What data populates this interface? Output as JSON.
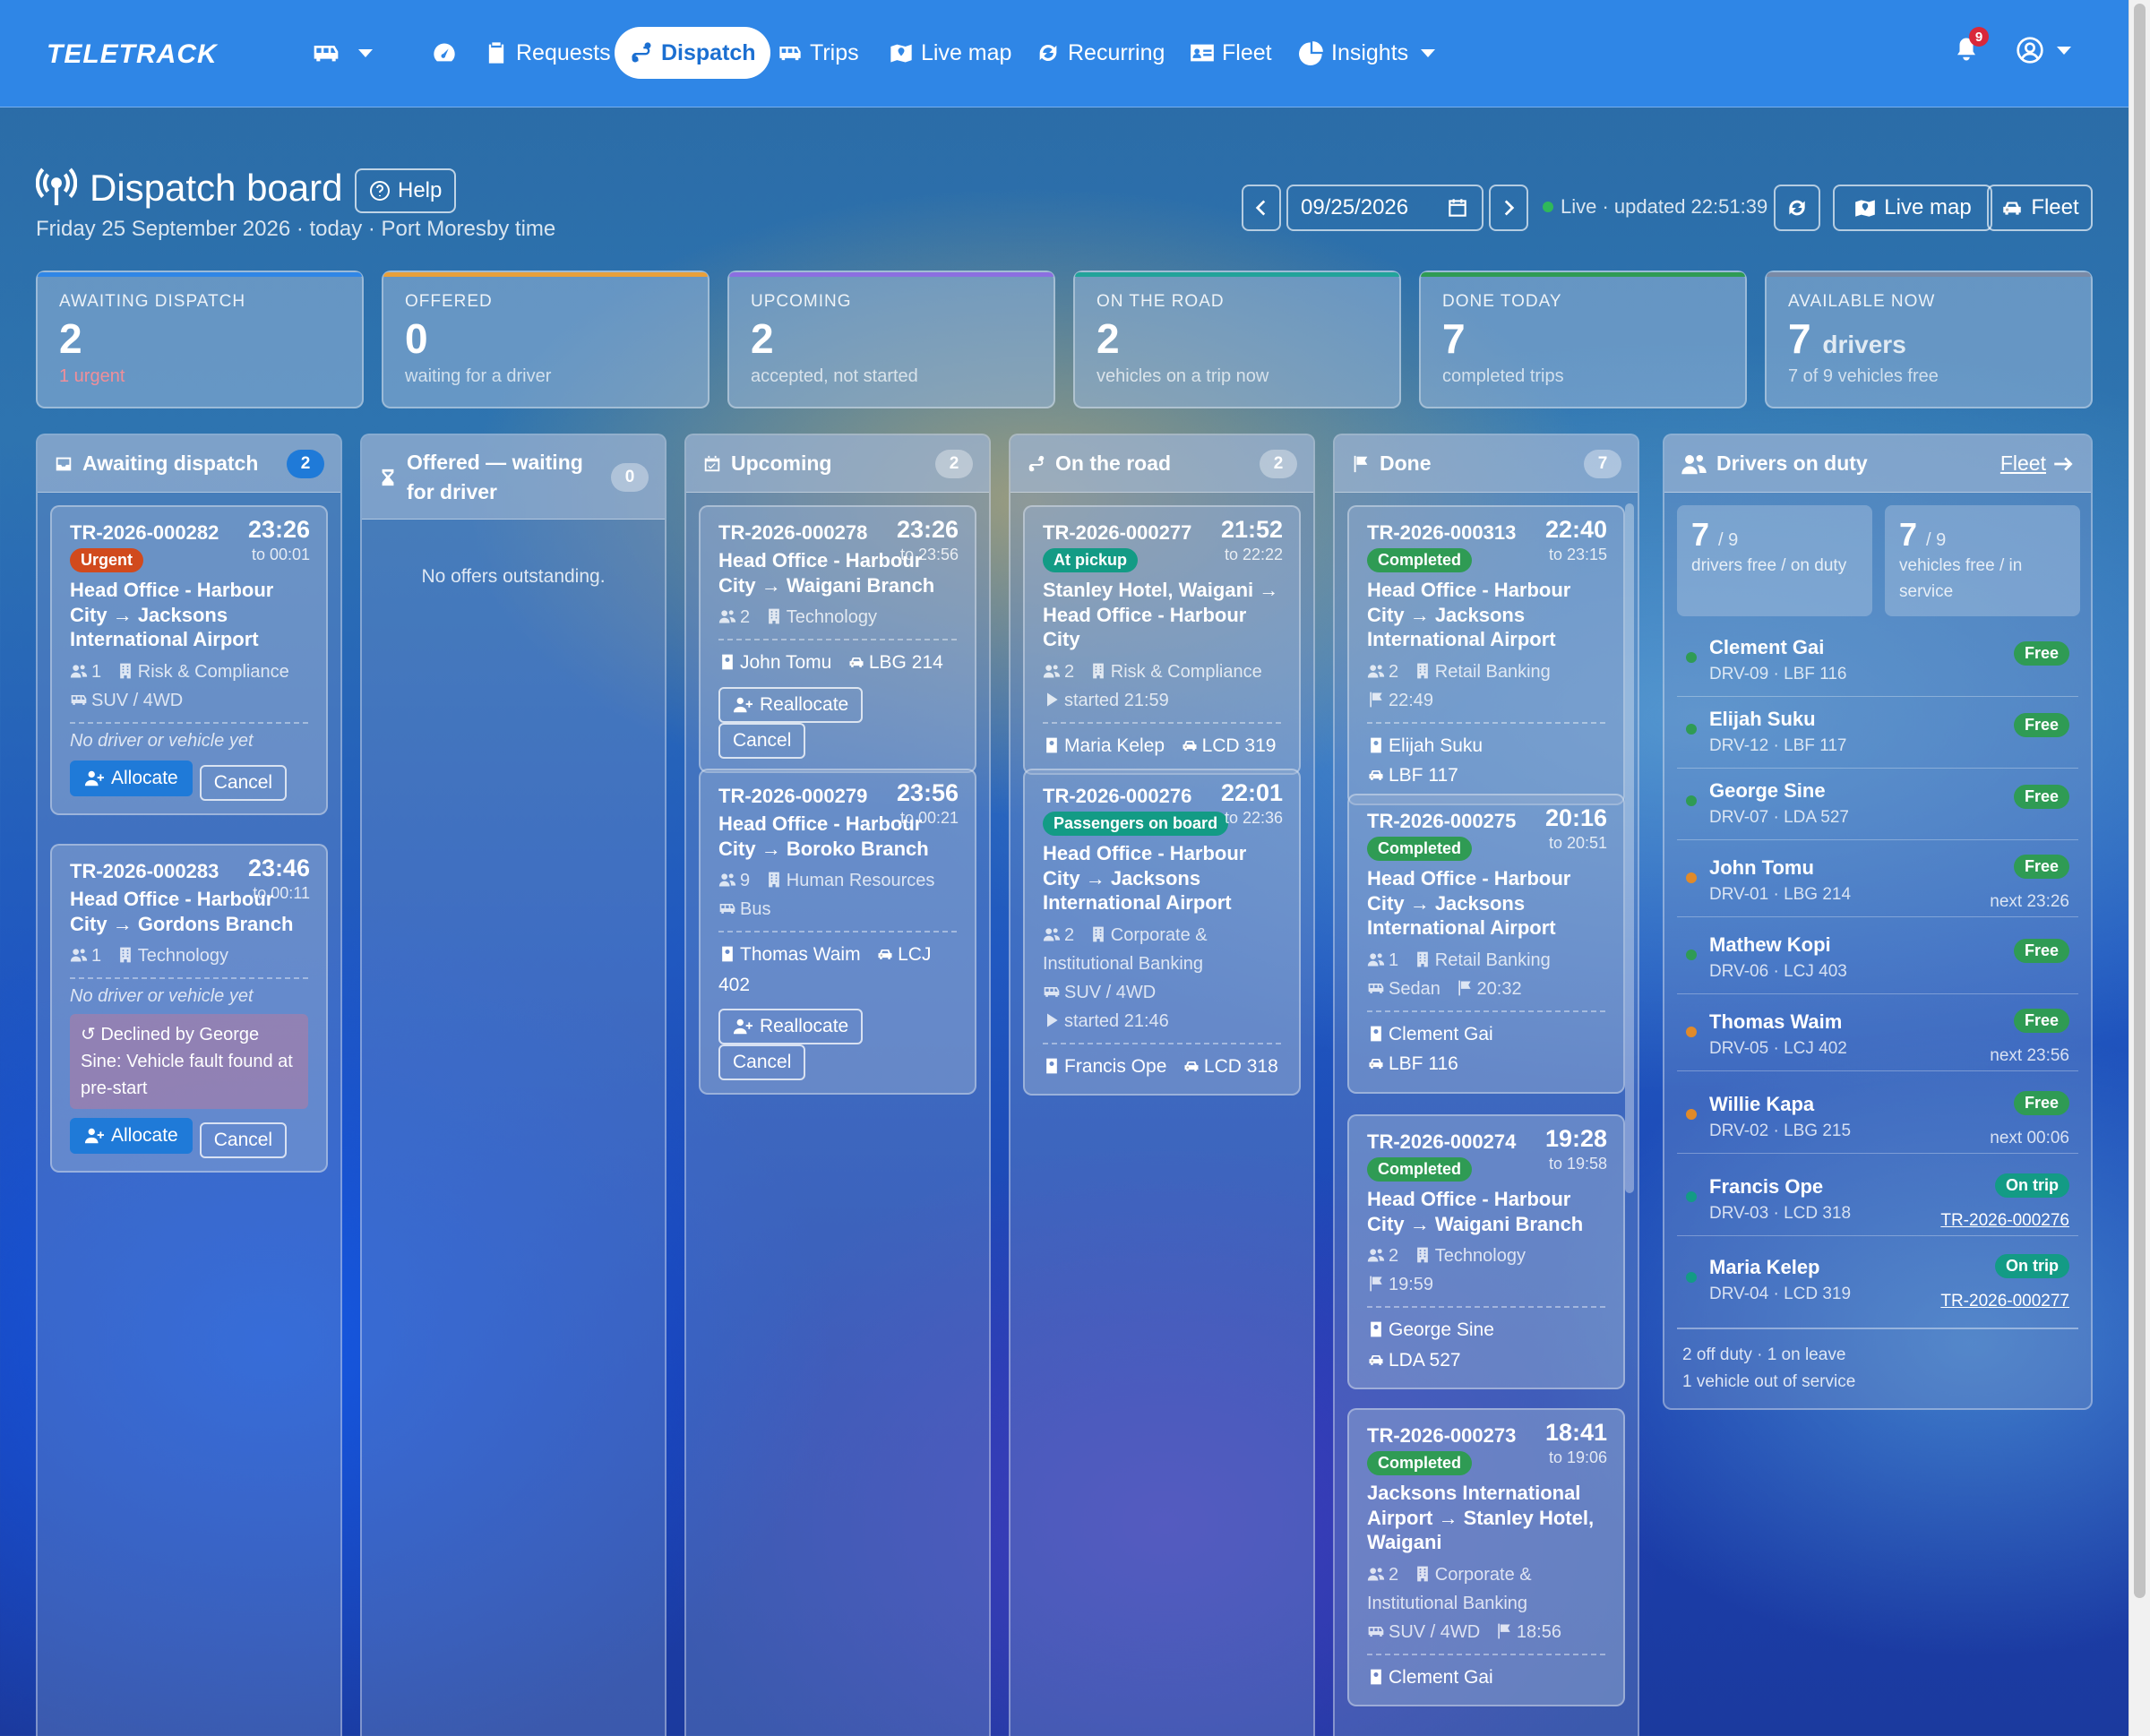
{
  "app": {
    "logo": "TELETRACK",
    "notifications": "9"
  },
  "nav": {
    "requests": "Requests",
    "dispatch": "Dispatch",
    "trips": "Trips",
    "live_map": "Live map",
    "recurring": "Recurring",
    "fleet": "Fleet",
    "insights": "Insights"
  },
  "header": {
    "title": "Dispatch board",
    "help": "Help",
    "subtitle": "Friday 25 September 2026 · today · Port Moresby time",
    "date": "09/25/2026",
    "live": "Live · updated 22:51:39",
    "live_map": "Live map",
    "fleet": "Fleet"
  },
  "stats": [
    {
      "label": "AWAITING DISPATCH",
      "value": "2",
      "sub": "1 urgent",
      "color": "#2f86e6"
    },
    {
      "label": "OFFERED",
      "value": "0",
      "sub": "waiting for a driver",
      "color": "#e8a03b"
    },
    {
      "label": "UPCOMING",
      "value": "2",
      "sub": "accepted, not started",
      "color": "#8b6fe0"
    },
    {
      "label": "ON THE ROAD",
      "value": "2",
      "sub": "vehicles on a trip now",
      "color": "#22a39a"
    },
    {
      "label": "DONE TODAY",
      "value": "7",
      "sub": "completed trips",
      "color": "#2f9b54"
    },
    {
      "label": "AVAILABLE NOW",
      "value": "7",
      "unit": "drivers",
      "sub": "7 of 9 vehicles free",
      "color": "#7a8aa6"
    }
  ],
  "columns": {
    "awaiting": {
      "title": "Awaiting dispatch",
      "count": "2"
    },
    "offered": {
      "title": "Offered — waiting for driver",
      "count": "0",
      "empty": "No offers outstanding."
    },
    "upcoming": {
      "title": "Upcoming",
      "count": "2"
    },
    "road": {
      "title": "On the road",
      "count": "2"
    },
    "done": {
      "title": "Done",
      "count": "7"
    },
    "drivers": {
      "title": "Drivers on duty",
      "link": "Fleet"
    }
  },
  "awaiting": [
    {
      "id": "TR-2026-000282",
      "time": "23:26",
      "to": "to 00:01",
      "badge": "Urgent",
      "from": "Head Office - Harbour City",
      "dest": "Jacksons International Airport",
      "pax": "1",
      "dept": "Risk & Compliance",
      "vehicle": "SUV / 4WD",
      "none": "No driver or vehicle yet",
      "allocate": "Allocate",
      "cancel": "Cancel"
    },
    {
      "id": "TR-2026-000283",
      "time": "23:46",
      "to": "to 00:11",
      "from": "Head Office - Harbour City",
      "dest": "Gordons Branch",
      "pax": "1",
      "dept": "Technology",
      "none": "No driver or vehicle yet",
      "declined": "Declined by George Sine: Vehicle fault found at pre-start",
      "allocate": "Allocate",
      "cancel": "Cancel"
    }
  ],
  "upcoming": [
    {
      "id": "TR-2026-000278",
      "time": "23:26",
      "to": "to 23:56",
      "from": "Head Office - Harbour City",
      "dest": "Waigani Branch",
      "pax": "2",
      "dept": "Technology",
      "driver": "John Tomu",
      "plate": "LBG 214",
      "realloc": "Reallocate",
      "cancel": "Cancel"
    },
    {
      "id": "TR-2026-000279",
      "time": "23:56",
      "to": "to 00:21",
      "from": "Head Office - Harbour City",
      "dest": "Boroko Branch",
      "pax": "9",
      "dept": "Human Resources",
      "vehicle": "Bus",
      "driver": "Thomas Waim",
      "plate": "LCJ 402",
      "realloc": "Reallocate",
      "cancel": "Cancel"
    }
  ],
  "road": [
    {
      "id": "TR-2026-000277",
      "time": "21:52",
      "to": "to 22:22",
      "badge": "At pickup",
      "from": "Stanley Hotel, Waigani",
      "dest": "Head Office - Harbour City",
      "pax": "2",
      "dept": "Risk & Compliance",
      "started": "started 21:59",
      "driver": "Maria Kelep",
      "plate": "LCD 319"
    },
    {
      "id": "TR-2026-000276",
      "time": "22:01",
      "to": "to 22:36",
      "badge": "Passengers on board",
      "from": "Head Office - Harbour City",
      "dest": "Jacksons International Airport",
      "pax": "2",
      "dept": "Corporate & Institutional Banking",
      "vehicle": "SUV / 4WD",
      "started": "started 21:46",
      "driver": "Francis Ope",
      "plate": "LCD 318"
    }
  ],
  "done": [
    {
      "id": "TR-2026-000313",
      "time": "22:40",
      "to": "to 23:15",
      "badge": "Completed",
      "from": "Head Office - Harbour City",
      "dest": "Jacksons International Airport",
      "pax": "2",
      "dept": "Retail Banking",
      "fin": "22:49",
      "driver": "Elijah Suku",
      "plate": "LBF 117"
    },
    {
      "id": "TR-2026-000275",
      "time": "20:16",
      "to": "to 20:51",
      "badge": "Completed",
      "from": "Head Office - Harbour City",
      "dest": "Jacksons International Airport",
      "pax": "1",
      "dept": "Retail Banking",
      "vehicle": "Sedan",
      "fin": "20:32",
      "driver": "Clement Gai",
      "plate": "LBF 116"
    },
    {
      "id": "TR-2026-000274",
      "time": "19:28",
      "to": "to 19:58",
      "badge": "Completed",
      "from": "Head Office - Harbour City",
      "dest": "Waigani Branch",
      "pax": "2",
      "dept": "Technology",
      "fin": "19:59",
      "driver": "George Sine",
      "plate": "LDA 527"
    },
    {
      "id": "TR-2026-000273",
      "time": "18:41",
      "to": "to 19:06",
      "badge": "Completed",
      "from": "Jacksons International Airport",
      "dest": "Stanley Hotel, Waigani",
      "pax": "2",
      "dept": "Corporate & Institutional Banking",
      "vehicle": "SUV / 4WD",
      "fin": "18:56",
      "driver": "Clement Gai"
    }
  ],
  "drivers_summary": {
    "drivers_free": "7",
    "drivers_total": "/ 9",
    "drivers_label": "drivers free / on duty",
    "vehicles_free": "7",
    "vehicles_total": "/ 9",
    "vehicles_label": "vehicles free / in service",
    "footer1": "2 off duty · 1 on leave",
    "footer2": "1 vehicle out of service"
  },
  "drivers": [
    {
      "name": "Clement Gai",
      "code": "DRV-09 · LBF 116",
      "status": "Free",
      "dot": "#2f9b54"
    },
    {
      "name": "Elijah Suku",
      "code": "DRV-12 · LBF 117",
      "status": "Free",
      "dot": "#2f9b54"
    },
    {
      "name": "George Sine",
      "code": "DRV-07 · LDA 527",
      "status": "Free",
      "dot": "#2f9b54"
    },
    {
      "name": "John Tomu",
      "code": "DRV-01 · LBG 214",
      "status": "Free",
      "next": "next 23:26",
      "dot": "#e08a2a"
    },
    {
      "name": "Mathew Kopi",
      "code": "DRV-06 · LCJ 403",
      "status": "Free",
      "dot": "#2f9b54"
    },
    {
      "name": "Thomas Waim",
      "code": "DRV-05 · LCJ 402",
      "status": "Free",
      "next": "next 23:56",
      "dot": "#e08a2a"
    },
    {
      "name": "Willie Kapa",
      "code": "DRV-02 · LBG 215",
      "status": "Free",
      "next": "next 00:06",
      "dot": "#e08a2a"
    },
    {
      "name": "Francis Ope",
      "code": "DRV-03 · LCD 318",
      "status": "On trip",
      "trip": "TR-2026-000276",
      "dot": "#139b85"
    },
    {
      "name": "Maria Kelep",
      "code": "DRV-04 · LCD 319",
      "status": "On trip",
      "trip": "TR-2026-000277",
      "dot": "#139b85"
    }
  ]
}
